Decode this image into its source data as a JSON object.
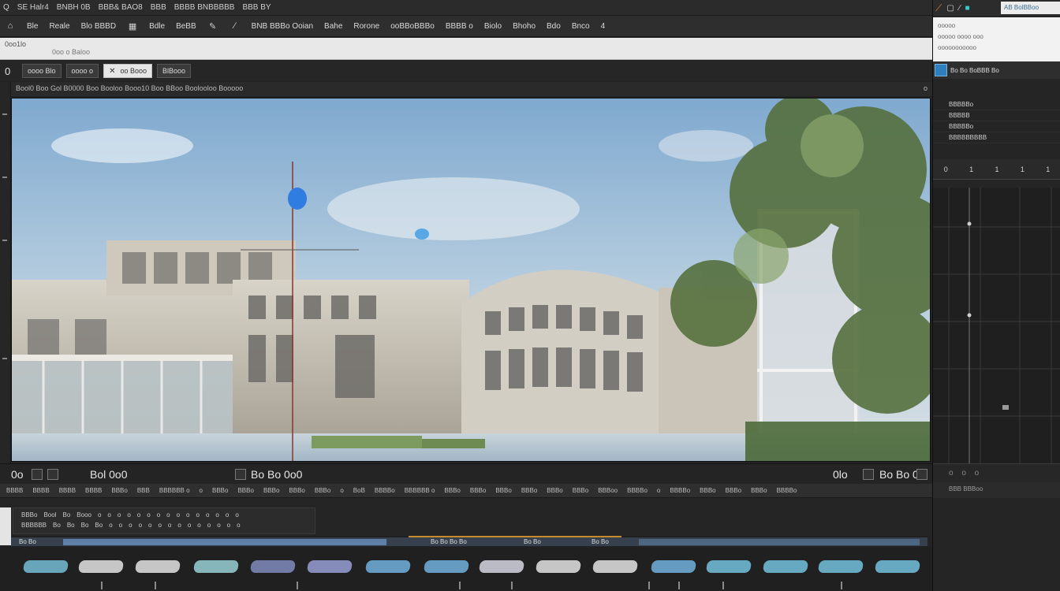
{
  "menubar": {
    "items": [
      "Q",
      "SE Halr4",
      "BNBH 0B",
      "BBB& BAO8",
      "BBB",
      "BBBB BNBBBBB",
      "BBB BY"
    ]
  },
  "toolbar": {
    "items": [
      "Ble",
      "Reale",
      "Blo BBBD",
      "Bdle",
      "BeBB",
      "BNB BBBo Ooian",
      "Bahe",
      "Rorone",
      "ooBBoBBBo",
      "BBBB o",
      "Biolo",
      "Bhoho",
      "Bdo",
      "Bnco",
      "4"
    ]
  },
  "strip": {
    "line1": "0oo1lo",
    "line2": "0oo o Baloo"
  },
  "doc_row": {
    "frame_number": "0",
    "tabs": [
      {
        "label": "oooo Blo"
      },
      {
        "label": "oooo o"
      },
      {
        "label": "oo Booo"
      },
      {
        "label": "BlBooo"
      }
    ]
  },
  "viewport": {
    "header": "Bool0 Boo Gol B0000 Boo Booloo Booo10 Boo BBoo Boolooloo Booooo",
    "header_right": "o"
  },
  "transport": {
    "left_time": "0o",
    "center_time": "Bol 0o0",
    "mid_time": "Bo Bo 0o0",
    "right_time": "0lo",
    "far_right": "Bo Bo 0"
  },
  "timeline_header": {
    "labels": [
      "BBBB",
      "BBBB",
      "BBBB",
      "BBBB",
      "BBBo",
      "BBB",
      "BBBBBB o",
      "o",
      "BBBo",
      "BBBo",
      "BBBo",
      "BBBo",
      "BBBo",
      "o",
      "BoB",
      "BBBBo",
      "BBBBBB o",
      "BBBo",
      "BBBo",
      "BBBo",
      "BBBo",
      "BBBo",
      "BBBo",
      "BBBoo",
      "BBBBo",
      "o",
      "BBBBo",
      "BBBo",
      "BBBo",
      "BBBo",
      "BBBBo"
    ]
  },
  "track": {
    "row1": [
      "BBBo",
      "Bool",
      "Bo",
      "Booo",
      "o",
      "o",
      "o",
      "o",
      "o",
      "o",
      "o",
      "o",
      "o",
      "o",
      "o",
      "o",
      "o",
      "o",
      "o"
    ],
    "row2": [
      "BBBBBB",
      "Bo",
      "Bo",
      "Bo",
      "Bo",
      "o",
      "o",
      "o",
      "o",
      "o",
      "o",
      "o",
      "o",
      "o",
      "o",
      "o",
      "o",
      "o",
      "o"
    ]
  },
  "bluebar": {
    "labels": [
      "Bo Bo",
      "Bo Bo Bo Bo",
      "Bo Bo",
      "Bo Bo"
    ]
  },
  "right_panel": {
    "top_logo": "AB BolBBoo",
    "white_lines": [
      "ooooo",
      "ooooo oooo ooo",
      "ooooooooooo"
    ],
    "header": "Bo Bo BoBBB Bo",
    "list": [
      "BBBBBo",
      "BBBBB",
      "BBBBBo",
      "BBBBBBBBB"
    ],
    "levels": [
      "0",
      "1",
      "1",
      "1",
      "1"
    ],
    "bottom_status": "o o o",
    "bottom_label": "BBB BBBoo"
  },
  "colors": {
    "accent": "#2f7fbf",
    "playhead": "#3a7fd6",
    "orange": "#c98a2e"
  }
}
